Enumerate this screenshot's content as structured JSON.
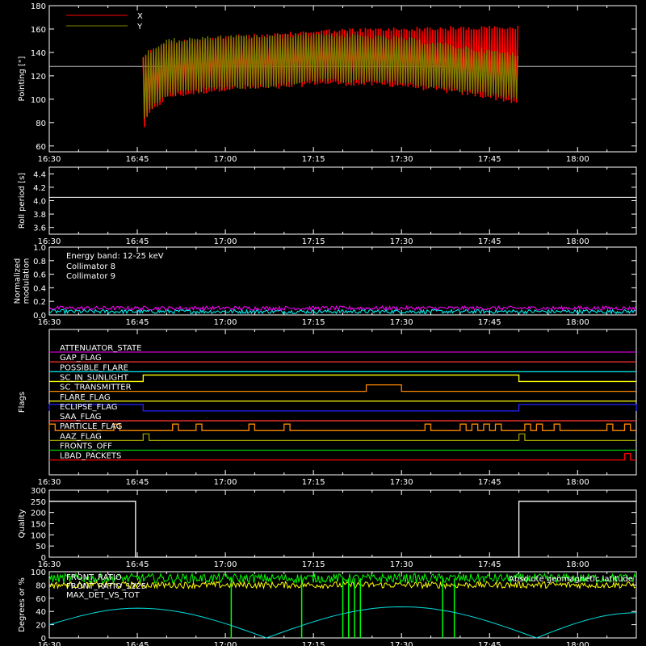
{
  "time_axis": {
    "range": [
      "16:30",
      "18:10"
    ],
    "ticks": [
      "16:30",
      "16:45",
      "17:00",
      "17:15",
      "17:30",
      "17:45",
      "18:00"
    ]
  },
  "data_window": {
    "start": "16:46",
    "end": "17:50"
  },
  "chart_data": [
    {
      "type": "area",
      "ylabel": "Pointing [\"]",
      "ylim": [
        55,
        180
      ],
      "yticks": [
        "60",
        "80",
        "100",
        "120",
        "140",
        "160",
        "180"
      ],
      "reference_line": 128,
      "legend": [
        {
          "name": "X",
          "color": "#ff0000"
        },
        {
          "name": "Y",
          "color": "#7f7f00"
        }
      ],
      "series": [
        {
          "name": "X",
          "color": "#ff0000",
          "envelope_time": [
            "16:46",
            "16:47",
            "16:50",
            "17:00",
            "17:10",
            "17:15",
            "17:30",
            "17:45",
            "17:50"
          ],
          "upper": [
            138,
            142,
            150,
            155,
            157,
            160,
            162,
            163,
            163
          ],
          "lower": [
            72,
            85,
            100,
            107,
            108,
            112,
            110,
            100,
            95
          ]
        },
        {
          "name": "Y",
          "color": "#7f7f00",
          "envelope_time": [
            "16:46",
            "16:47",
            "16:50",
            "17:00",
            "17:10",
            "17:15",
            "17:30",
            "17:45",
            "17:50"
          ],
          "upper": [
            140,
            143,
            152,
            155,
            156,
            158,
            154,
            143,
            140
          ],
          "lower": [
            78,
            88,
            102,
            108,
            110,
            114,
            112,
            102,
            98
          ]
        }
      ]
    },
    {
      "type": "line",
      "ylabel": "Roll period [s]",
      "ylim": [
        3.5,
        4.5
      ],
      "yticks": [
        "3.6",
        "3.8",
        "4.0",
        "4.2",
        "4.4"
      ],
      "series": [
        {
          "color": "#ffffff",
          "value": 4.05
        }
      ]
    },
    {
      "type": "line",
      "ylabel": "Normalized modulation",
      "ylim": [
        0,
        1.0
      ],
      "yticks": [
        "0.0",
        "0.2",
        "0.4",
        "0.6",
        "0.8",
        "1.0"
      ],
      "annotation": "Energy band: 12-25 keV",
      "legend": [
        {
          "name": "Collimator 8",
          "color": "#00ffff"
        },
        {
          "name": "Collimator 9",
          "color": "#ff00ff"
        }
      ],
      "series": [
        {
          "name": "Collimator 8",
          "color": "#00ffff",
          "mean": 0.05
        },
        {
          "name": "Collimator 9",
          "color": "#ff00ff",
          "mean": 0.1
        }
      ]
    },
    {
      "type": "line",
      "ylabel": "Flags",
      "flags": [
        {
          "name": "ATTENUATOR_STATE",
          "color": "#cc00cc",
          "high": []
        },
        {
          "name": "GAP_FLAG",
          "color": "#ff3333",
          "high": []
        },
        {
          "name": "POSSIBLE_FLARE",
          "color": "#00dddd",
          "high": []
        },
        {
          "name": "SC_IN_SUNLIGHT",
          "color": "#ffff00",
          "high": [
            [
              "16:46",
              "17:50"
            ]
          ]
        },
        {
          "name": "SC_TRANSMITTER",
          "color": "#ff8800",
          "high": [
            [
              "17:24",
              "17:30"
            ]
          ]
        },
        {
          "name": "FLARE_FLAG",
          "color": "#ffff00",
          "high": []
        },
        {
          "name": "ECLIPSE_FLAG",
          "color": "#2222ff",
          "high": [
            [
              "16:30",
              "16:46"
            ],
            [
              "17:50",
              "18:10"
            ]
          ]
        },
        {
          "name": "SAA_FLAG",
          "color": "#ff3333",
          "high": []
        },
        {
          "name": "PARTICLE_FLAG",
          "color": "#ff8800",
          "high": [
            [
              "16:30",
              "16:31"
            ],
            [
              "16:41",
              "16:42"
            ],
            [
              "16:51",
              "16:52"
            ],
            [
              "16:55",
              "16:56"
            ],
            [
              "17:04",
              "17:05"
            ],
            [
              "17:10",
              "17:11"
            ],
            [
              "17:34",
              "17:35"
            ],
            [
              "17:40",
              "17:41"
            ],
            [
              "17:42",
              "17:43"
            ],
            [
              "17:44",
              "17:45"
            ],
            [
              "17:46",
              "17:47"
            ],
            [
              "17:51",
              "17:52"
            ],
            [
              "17:53",
              "17:54"
            ],
            [
              "17:56",
              "17:57"
            ],
            [
              "18:05",
              "18:06"
            ],
            [
              "18:08",
              "18:09"
            ]
          ]
        },
        {
          "name": "AAZ_FLAG",
          "color": "#999900",
          "high": [
            [
              "16:46",
              "16:47"
            ],
            [
              "17:50",
              "17:51"
            ]
          ]
        },
        {
          "name": "FRONTS_OFF",
          "color": "#00cc00",
          "high": []
        },
        {
          "name": "LBAD_PACKETS",
          "color": "#ff0000",
          "high": [
            [
              "18:08",
              "18:09"
            ]
          ]
        }
      ]
    },
    {
      "type": "line",
      "ylabel": "Quality",
      "ylim": [
        0,
        300
      ],
      "yticks": [
        "0",
        "50",
        "100",
        "150",
        "200",
        "250",
        "300"
      ],
      "series": [
        {
          "color": "#ffffff",
          "outside_window": 250,
          "inside_window": 0
        }
      ]
    },
    {
      "type": "line",
      "ylabel": "Degrees or %",
      "ylim": [
        0,
        100
      ],
      "yticks": [
        "0",
        "20",
        "40",
        "60",
        "80",
        "100"
      ],
      "legend": [
        {
          "name": "FRONT_RATIO",
          "color": "#00ff00"
        },
        {
          "name": "FRONT_RATIO_1225",
          "color": "#00ff00"
        },
        {
          "name": "MAX_DET_VS_TOT",
          "color": "#ffff00"
        },
        {
          "name": "Absolute geomagnetic latitude",
          "color": "#00dddd"
        }
      ],
      "series": [
        {
          "name": "FRONT_RATIO",
          "color": "#00ff00",
          "mean": 90,
          "dropouts": [
            "17:01",
            "17:13",
            "17:20",
            "17:21",
            "17:22",
            "17:23",
            "17:37",
            "17:39"
          ]
        },
        {
          "name": "MAX_DET_VS_TOT",
          "color": "#ffff00",
          "mean": 80
        },
        {
          "name": "Absolute geomagnetic latitude",
          "color": "#00dddd",
          "peaks": [
            [
              "16:45",
              45
            ],
            [
              "17:30",
              47
            ]
          ],
          "troughs": [
            [
              "17:07",
              0
            ],
            [
              "17:53",
              0
            ]
          ],
          "end": [
            "18:10",
            38
          ]
        }
      ]
    }
  ]
}
